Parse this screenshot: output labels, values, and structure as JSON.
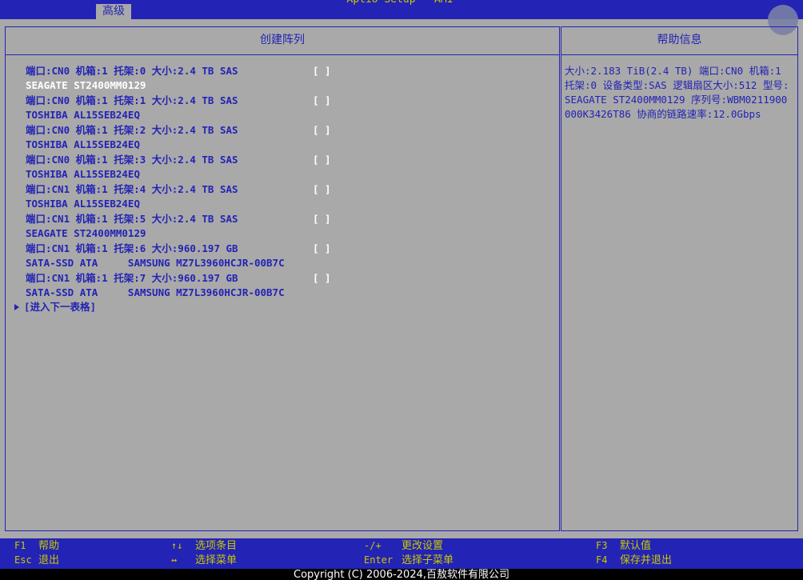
{
  "window": {
    "title": "Aptio Setup - AMI"
  },
  "tabs": [
    {
      "label": "高级",
      "active": true
    }
  ],
  "main": {
    "header": "创建阵列",
    "disks": [
      {
        "line1": "端口:CN0 机箱:1 托架:0 大小:2.4 TB SAS",
        "selector": "[ ]",
        "line2": "SEAGATE ST2400MM0129",
        "highlighted": true
      },
      {
        "line1": "端口:CN0 机箱:1 托架:1 大小:2.4 TB SAS",
        "selector": "[ ]",
        "line2": "TOSHIBA AL15SEB24EQ",
        "highlighted": false
      },
      {
        "line1": "端口:CN0 机箱:1 托架:2 大小:2.4 TB SAS",
        "selector": "[ ]",
        "line2": "TOSHIBA AL15SEB24EQ",
        "highlighted": false
      },
      {
        "line1": "端口:CN0 机箱:1 托架:3 大小:2.4 TB SAS",
        "selector": "[ ]",
        "line2": "TOSHIBA AL15SEB24EQ",
        "highlighted": false
      },
      {
        "line1": "端口:CN1 机箱:1 托架:4 大小:2.4 TB SAS",
        "selector": "[ ]",
        "line2": "TOSHIBA AL15SEB24EQ",
        "highlighted": false
      },
      {
        "line1": "端口:CN1 机箱:1 托架:5 大小:2.4 TB SAS",
        "selector": "[ ]",
        "line2": "SEAGATE ST2400MM0129",
        "highlighted": false
      },
      {
        "line1": "端口:CN1 机箱:1 托架:6 大小:960.197 GB",
        "selector": "[ ]",
        "line2": "SATA-SSD ATA     SAMSUNG MZ7L3960HCJR-00B7C",
        "highlighted": false
      },
      {
        "line1": "端口:CN1 机箱:1 托架:7 大小:960.197 GB",
        "selector": "[ ]",
        "line2": "SATA-SSD ATA     SAMSUNG MZ7L3960HCJR-00B7C",
        "highlighted": false
      }
    ],
    "next_table": "[进入下一表格]"
  },
  "help": {
    "header": "帮助信息",
    "text": "大小:2.183 TiB(2.4 TB) 端口:CN0 机箱:1 托架:0 设备类型:SAS 逻辑扇区大小:512 型号:SEAGATE ST2400MM0129 序列号:WBM0211900000K3426T86 协商的链路速率:12.0Gbps"
  },
  "keys": {
    "f1": {
      "key": "F1",
      "desc": "帮助"
    },
    "esc": {
      "key": "Esc",
      "desc": "退出"
    },
    "updown": {
      "key": "↑↓",
      "desc": "选项条目"
    },
    "leftright": {
      "key": "↔",
      "desc": "选择菜单"
    },
    "plusminus": {
      "key": "-/+",
      "desc": "更改设置"
    },
    "enter": {
      "key": "Enter",
      "desc": "选择子菜单"
    },
    "f3": {
      "key": "F3",
      "desc": "默认值"
    },
    "f4": {
      "key": "F4",
      "desc": "保存并退出"
    }
  },
  "footer": {
    "copyright": "Copyright (C) 2006-2024,百敖软件有限公司"
  },
  "colors": {
    "background": "#a9a9a9",
    "accent_blue": "#2323b5",
    "key_yellow": "#c8c800",
    "highlight_white": "#ffffff"
  }
}
